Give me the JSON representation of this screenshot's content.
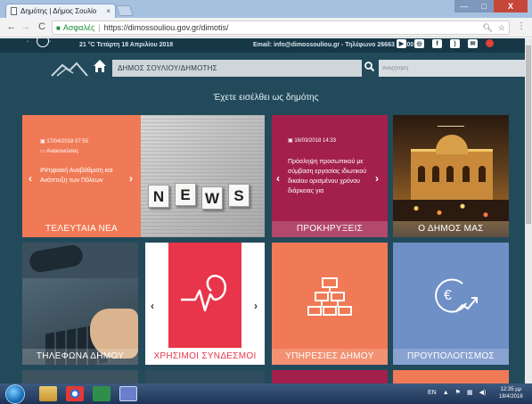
{
  "browser": {
    "tab_title": "Δημότης | Δήμος Σουλίο",
    "tab_close": "×",
    "nav_back": "←",
    "nav_forward": "→",
    "nav_reload": "C",
    "security_label": "Ασφαλές",
    "url_separator": "|",
    "url": "https://dimossouliou.gov.gr/dimotis/",
    "zoom_icon": "🔍︎",
    "star_icon": "☆",
    "menu_icon": "⋮",
    "win_min": "—",
    "win_max": "□",
    "win_close": "X"
  },
  "topinfo": {
    "weather": "21 °C   Τετάρτη 18 Απριλίου 2018",
    "contact": "Email: info@dimossouliou.gr - Τηλέφωνο 26663 60100",
    "social_icons": [
      "youtube-icon",
      "instagram-icon",
      "facebook-icon",
      "rss-icon",
      "mail-icon",
      "heart-icon"
    ]
  },
  "header": {
    "breadcrumb": "ΔΗΜΟΣ ΣΟΥΛΙΟΥ/ΔΗΜΟΤΗΣ",
    "search_placeholder": "Αναζήτηση"
  },
  "welcome": "Έχετε εισέλθει ως δημότης",
  "tiles": {
    "news": {
      "date": "17/04/2018 07:55",
      "category": "Ανακοινώσεις",
      "title": "#Ψηφιακή Αναβάθμιση και Ανάπτυξη των Πόλεων",
      "label": "ΤΕΛΕΥΤΑΙΑ ΝΕΑ",
      "letters": [
        "N",
        "E",
        "W",
        "S"
      ]
    },
    "announcements": {
      "date": "16/03/2018 14:33",
      "body": "Πρόσληψη προσωπικού με σύμβαση εργασίας ιδιωτικού δικαίου ορισμένου χρόνου διάρκειας για",
      "label": "ΠΡΟΚΗΡΥΞΕΙΣ"
    },
    "municipality": {
      "label": "Ο ΔΗΜΟΣ ΜΑΣ"
    },
    "phones": {
      "label": "ΤΗΛΕΦΩΝΑ ΔΗΜΟΥ"
    },
    "links": {
      "label": "ΧΡΗΣΙΜΟΙ ΣΥΝΔΕΣΜΟΙ"
    },
    "services": {
      "label": "ΥΠΗΡΕΣΙΕΣ ΔΗΜΟΥ"
    },
    "budget": {
      "label": "ΠΡΟΥΠΟΛΟΓΙΣΜΟΣ"
    },
    "arrow_left": "‹",
    "arrow_right": "›"
  },
  "taskbar": {
    "lang": "EN",
    "time": "12:35 μμ",
    "date": "18/4/2018"
  }
}
